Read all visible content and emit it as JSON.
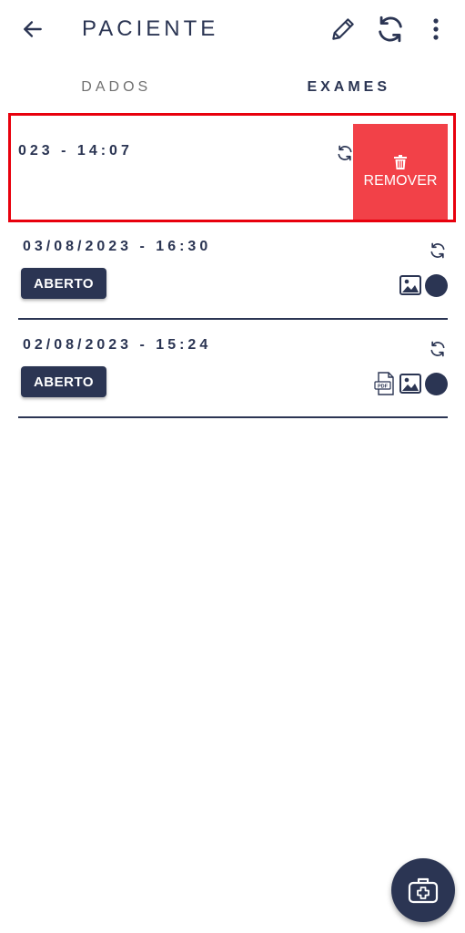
{
  "appbar": {
    "title": "PACIENTE",
    "back_icon": "arrow-left-icon",
    "edit_icon": "pencil-icon",
    "sync_icon": "sync-icon",
    "more_icon": "more-vertical-icon"
  },
  "tabs": [
    {
      "label": "DADOS",
      "active": false
    },
    {
      "label": "EXAMES",
      "active": true
    }
  ],
  "swiped_item": {
    "date_partial": "023 - 14:07",
    "remove_label": "REMOVER",
    "remove_icon": "trash-icon"
  },
  "exams": [
    {
      "date": "03/08/2023 - 16:30",
      "status": "ABERTO",
      "attachments": [
        "image-icon"
      ]
    },
    {
      "date": "02/08/2023 - 15:24",
      "status": "ABERTO",
      "attachments": [
        "pdf-icon",
        "image-icon"
      ]
    }
  ],
  "fab": {
    "icon": "medical-kit-icon"
  },
  "colors": {
    "primary": "#2b3553",
    "remove": "#f24148",
    "highlight_border": "#e8000d",
    "inactive_tab": "#707070"
  }
}
